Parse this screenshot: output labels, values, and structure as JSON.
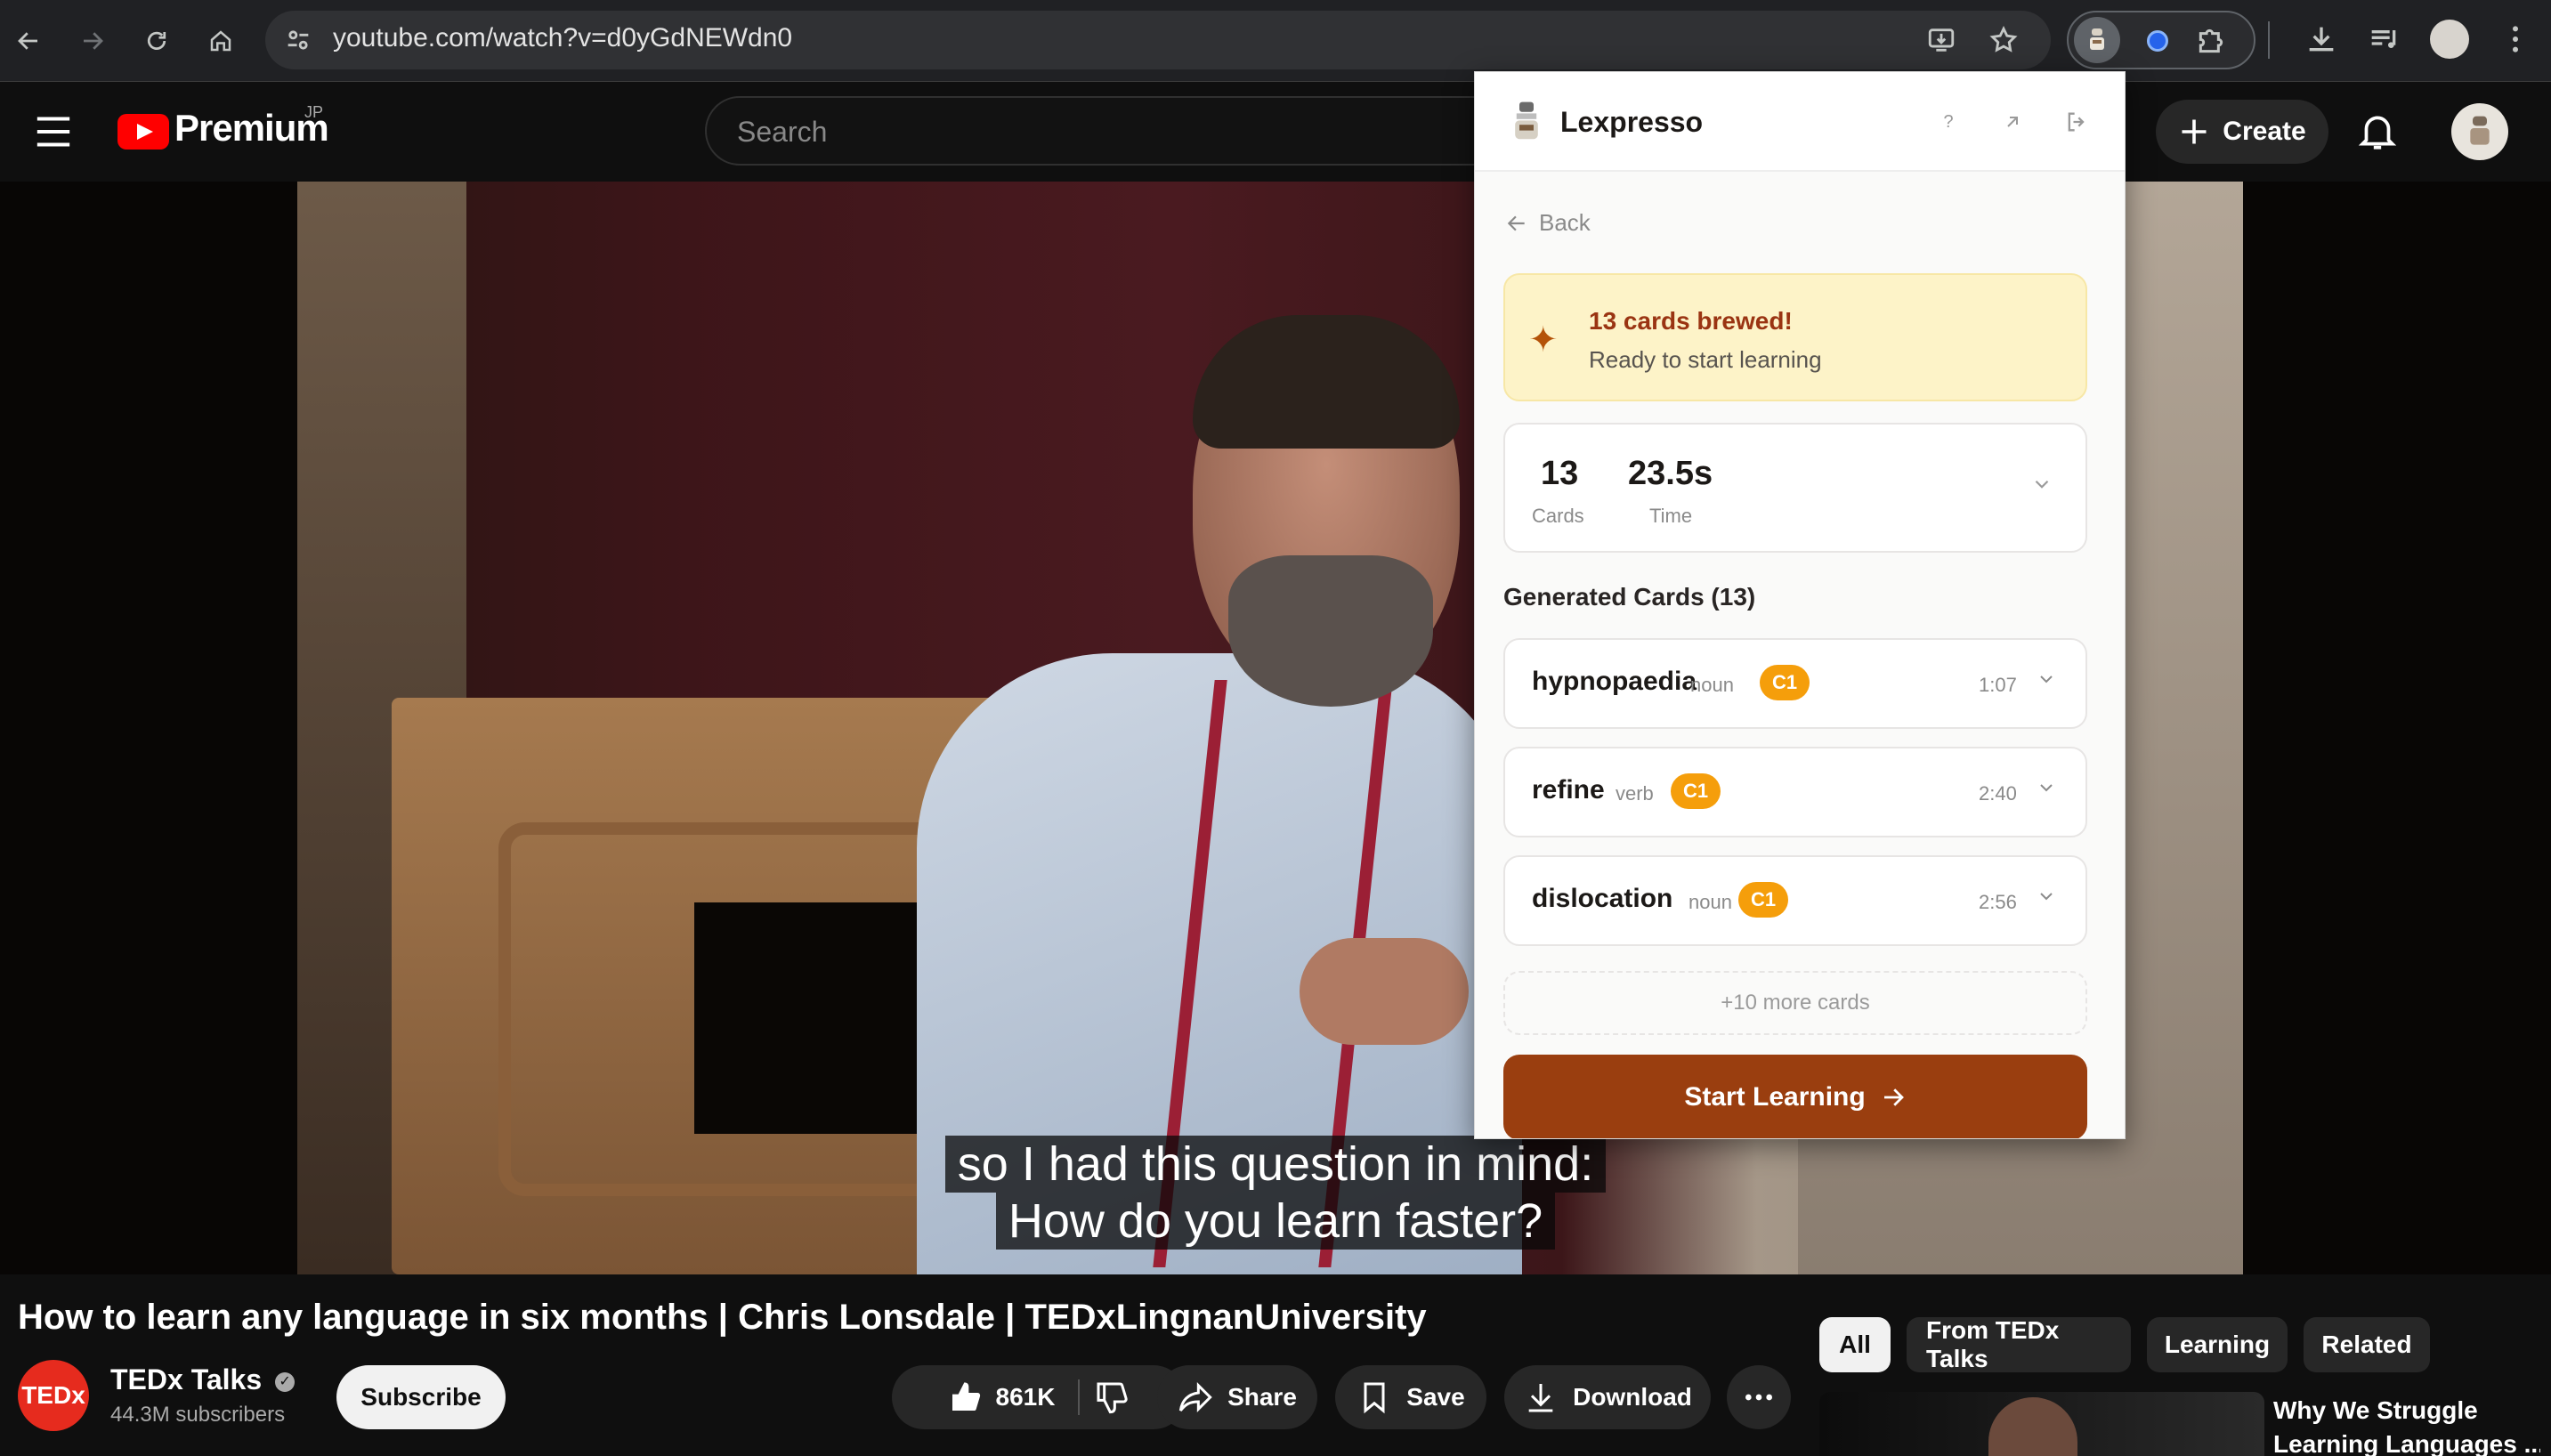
{
  "browser": {
    "url": "youtube.com/watch?v=d0yGdNEWdn0"
  },
  "youtube": {
    "logo_text": "Premium",
    "region": "JP",
    "search_placeholder": "Search",
    "create_label": "Create"
  },
  "video": {
    "caption_line1": "so I had this question in mind:",
    "caption_line2": "How do you learn faster?",
    "title": "How to learn any language in six months | Chris Lonsdale | TEDxLingnanUniversity"
  },
  "channel": {
    "avatar_text": "TEDx",
    "name": "TEDx Talks",
    "subscribers": "44.3M subscribers",
    "subscribe_label": "Subscribe"
  },
  "actions": {
    "likes": "861K",
    "share": "Share",
    "save": "Save",
    "download": "Download"
  },
  "chips": [
    "All",
    "From TEDx Talks",
    "Learning",
    "Related"
  ],
  "recommendation": {
    "title_line1": "Why We Struggle",
    "title_line2": "Learning Languages ..."
  },
  "extension": {
    "name": "Lexpresso",
    "help": "?",
    "back_label": "Back",
    "banner_title": "13 cards brewed!",
    "banner_subtitle": "Ready to start learning",
    "stats": {
      "cards_value": "13",
      "cards_label": "Cards",
      "time_value": "23.5s",
      "time_label": "Time"
    },
    "generated_heading": "Generated Cards (13)",
    "cards": [
      {
        "word": "hypnopaedia",
        "pos": "noun",
        "level": "C1",
        "time": "1:07"
      },
      {
        "word": "refine",
        "pos": "verb",
        "level": "C1",
        "time": "2:40"
      },
      {
        "word": "dislocation",
        "pos": "noun",
        "level": "C1",
        "time": "2:56"
      }
    ],
    "more_label": "+10 more cards",
    "start_label": "Start Learning"
  }
}
